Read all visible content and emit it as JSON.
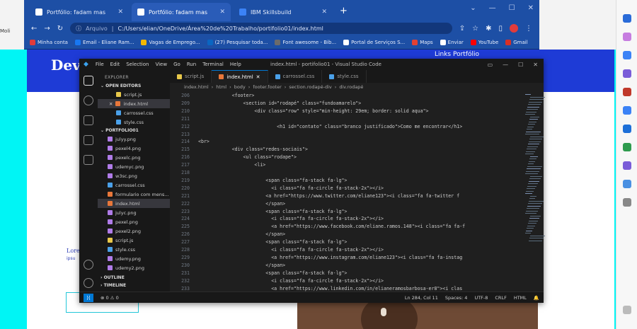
{
  "browser": {
    "tabs": [
      {
        "label": "Portfólio: fadam mas"
      },
      {
        "label": "Portfólio: fadam mas"
      },
      {
        "label": "IBM Skillsbuild"
      }
    ],
    "address_label": "Arquivo",
    "url": "C:/Users/elian/OneDrive/Área%20de%20Trabalho/portifolio01/index.html",
    "bookmarks": [
      {
        "label": "Minha conta",
        "color": "#e03b3b"
      },
      {
        "label": "Email - Eliane Ram...",
        "color": "#1877f2"
      },
      {
        "label": "Vagas de Emprego...",
        "color": "#f5b800"
      },
      {
        "label": "(27) Pesquisar toda...",
        "color": "#0a66c2"
      },
      {
        "label": "Font awesome - Bib...",
        "color": "#6b6b6b"
      },
      {
        "label": "Portal de Serviços S...",
        "color": "#ffffff"
      },
      {
        "label": "Maps",
        "color": "#e34133"
      },
      {
        "label": "Enviar",
        "color": "#ffffff"
      },
      {
        "label": "YouTube",
        "color": "#ff0000"
      },
      {
        "label": "Gmail",
        "color": "#d93025"
      }
    ]
  },
  "edge": {
    "behind_tab": "Moli"
  },
  "page": {
    "title": "Dev",
    "right_text": "Links Portfólio",
    "lorem": "Lorem",
    "lorem_sub": "ipsu"
  },
  "vscode": {
    "menu": [
      "File",
      "Edit",
      "Selection",
      "View",
      "Go",
      "Run",
      "Terminal",
      "Help"
    ],
    "window_title": "index.html - portifolio01 - Visual Studio Code",
    "explorer_header": "EXPLORER",
    "open_editors_header": "OPEN EDITORS",
    "open_editors": [
      {
        "name": "script.js",
        "color": "#e8c84a"
      },
      {
        "name": "index.html",
        "color": "#e8773a",
        "active": true
      },
      {
        "name": "carrossel.css",
        "color": "#4aa0e8"
      },
      {
        "name": "style.css",
        "color": "#4aa0e8"
      }
    ],
    "folder_header": "PORTFOLIO01",
    "files": [
      {
        "name": "julyy.png",
        "color": "#b07ce8"
      },
      {
        "name": "pexel4.png",
        "color": "#b07ce8"
      },
      {
        "name": "pexelc.png",
        "color": "#b07ce8"
      },
      {
        "name": "udemyc.png",
        "color": "#b07ce8"
      },
      {
        "name": "w3sc.png",
        "color": "#b07ce8"
      },
      {
        "name": "carrossel.css",
        "color": "#4aa0e8"
      },
      {
        "name": "formulario com mens...",
        "color": "#e8773a"
      },
      {
        "name": "index.html",
        "color": "#e8773a",
        "active": true
      },
      {
        "name": "julyc.png",
        "color": "#b07ce8"
      },
      {
        "name": "pexel.png",
        "color": "#b07ce8"
      },
      {
        "name": "pexel2.png",
        "color": "#b07ce8"
      },
      {
        "name": "script.js",
        "color": "#e8c84a"
      },
      {
        "name": "style.css",
        "color": "#4aa0e8"
      },
      {
        "name": "udemy.png",
        "color": "#b07ce8"
      },
      {
        "name": "udemy2.png",
        "color": "#b07ce8"
      }
    ],
    "outline_header": "OUTLINE",
    "timeline_header": "TIMELINE",
    "editor_tabs": [
      {
        "name": "script.js",
        "color": "#e8c84a"
      },
      {
        "name": "index.html",
        "color": "#e8773a",
        "active": true
      },
      {
        "name": "carrossel.css",
        "color": "#4aa0e8"
      },
      {
        "name": "style.css",
        "color": "#4aa0e8"
      }
    ],
    "breadcrumbs": [
      "index.html",
      "html",
      "body",
      "footer.footer",
      "section.rodapé-div",
      "div.rodapé"
    ],
    "code_lines": [
      {
        "n": "206",
        "text": "            <footer>"
      },
      {
        "n": "209",
        "text": "                <section id=\"rodapé\" class=\"fundoamarelo\">"
      },
      {
        "n": "210",
        "text": "                    <div class=\"row\" style=\"min-height: 29em; border: solid aqua\">"
      },
      {
        "n": "211",
        "text": ""
      },
      {
        "n": "212",
        "text": "                            <h1 id=\"contato\" class=\"branco justificado\">Como me encontrar</h1>"
      },
      {
        "n": "213",
        "text": ""
      },
      {
        "n": "214",
        "text": "<br>"
      },
      {
        "n": "215",
        "text": "            <div class=\"redes-sociais\">"
      },
      {
        "n": "216",
        "text": "                <ul class=\"rodape\">"
      },
      {
        "n": "217",
        "text": "                    <li>"
      },
      {
        "n": "218",
        "text": ""
      },
      {
        "n": "219",
        "text": "                        <span class=\"fa-stack fa-lg\">"
      },
      {
        "n": "220",
        "text": "                          <i class=\"fa fa-circle fa-stack-2x\"></i>"
      },
      {
        "n": "221",
        "text": "                        <a href=\"https://www.twitter.com/eliane123\"><i class=\"fa fa-twitter f"
      },
      {
        "n": "222",
        "text": "                        </span>"
      },
      {
        "n": "223",
        "text": "                        <span class=\"fa-stack fa-lg\">"
      },
      {
        "n": "224",
        "text": "                          <i class=\"fa fa-circle fa-stack-2x\"></i>"
      },
      {
        "n": "225",
        "text": "                          <a href=\"https://www.facebook.com/eliane.ramos.148\"><i class=\"fa fa-f"
      },
      {
        "n": "226",
        "text": "                        </span>"
      },
      {
        "n": "227",
        "text": "                        <span class=\"fa-stack fa-lg\">"
      },
      {
        "n": "228",
        "text": "                          <i class=\"fa fa-circle fa-stack-2x\"></i>"
      },
      {
        "n": "229",
        "text": "                          <a href=\"https://www.instagram.com/eliane123\"><i class=\"fa fa-instag"
      },
      {
        "n": "230",
        "text": "                        </span>"
      },
      {
        "n": "231",
        "text": "                        <span class=\"fa-stack fa-lg\">"
      },
      {
        "n": "232",
        "text": "                          <i class=\"fa fa-circle fa-stack-2x\"></i>"
      },
      {
        "n": "233",
        "text": "                          <a href=\"https://www.linkedin.com/in/elianeramosbarbosa-er8\"><i clas"
      }
    ],
    "status": {
      "errors": "0",
      "warnings": "0",
      "position": "Ln 284, Col 11",
      "spaces": "Spaces: 4",
      "encoding": "UTF-8",
      "eol": "CRLF",
      "language": "HTML"
    }
  }
}
